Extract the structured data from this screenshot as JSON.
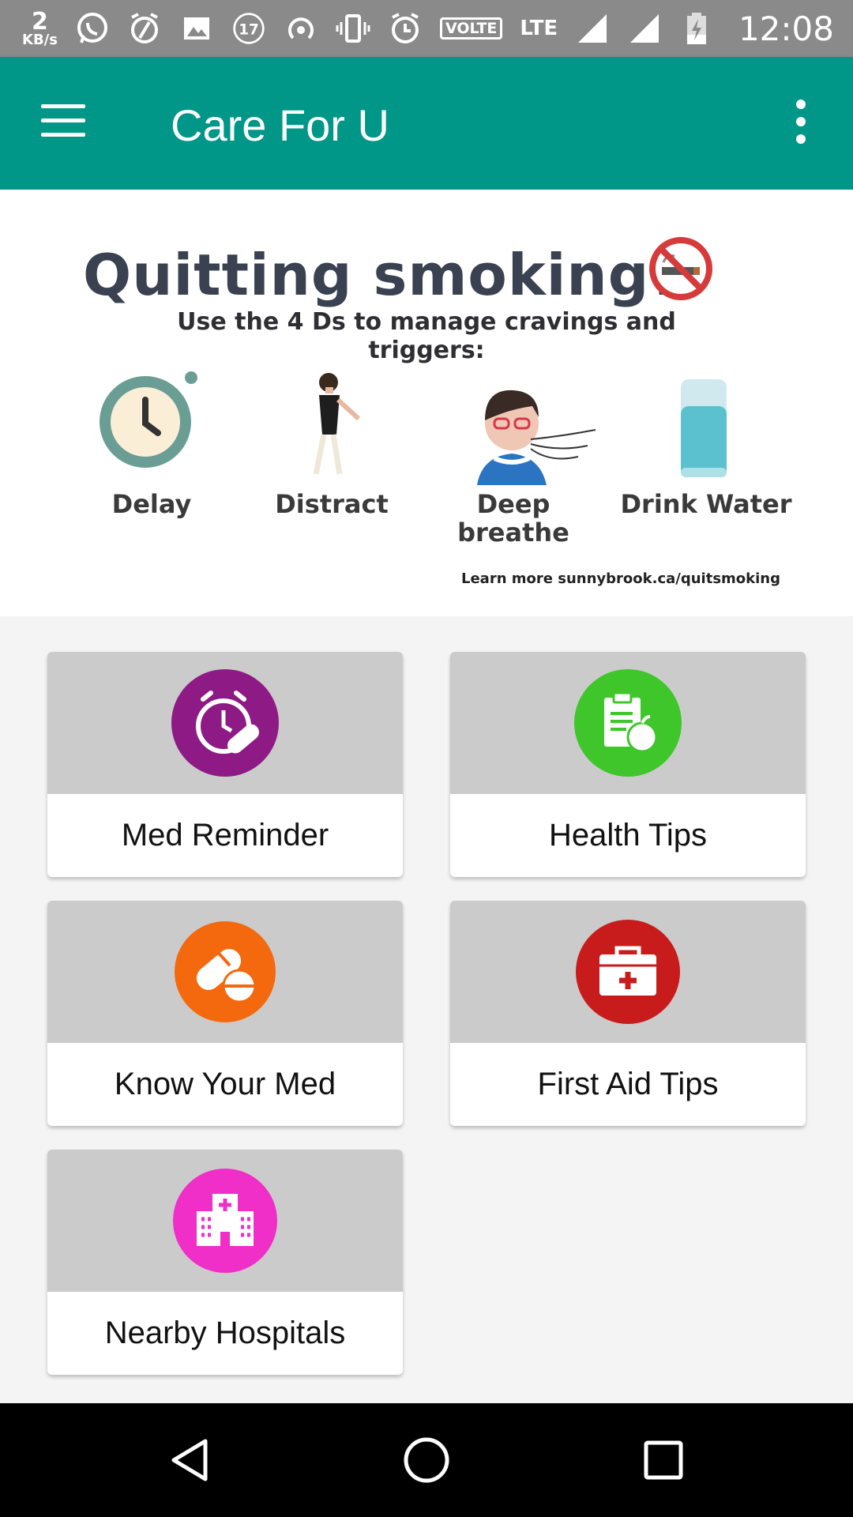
{
  "status_bar": {
    "network_speed_value": "2",
    "network_speed_unit": "KB/s",
    "notification_count": "17",
    "volte": "VOLTE",
    "lte": "LTE",
    "time": "12:08"
  },
  "app_bar": {
    "title": "Care For U"
  },
  "banner": {
    "title": "Quitting smoking?",
    "subtitle": "Use the 4 Ds to manage cravings and triggers:",
    "items": [
      {
        "label": "Delay"
      },
      {
        "label": "Distract"
      },
      {
        "label": "Deep breathe"
      },
      {
        "label": "Drink Water"
      }
    ],
    "link": "Learn more sunnybrook.ca/quitsmoking"
  },
  "cards": [
    {
      "label": "Med Reminder",
      "icon": "alarm-pill-icon",
      "color": "#8e1a85"
    },
    {
      "label": "Health Tips",
      "icon": "clipboard-apple-icon",
      "color": "#3ec62a"
    },
    {
      "label": "Know Your Med",
      "icon": "pill-capsule-icon",
      "color": "#f4680e"
    },
    {
      "label": "First Aid Tips",
      "icon": "first-aid-kit-icon",
      "color": "#c81c1c"
    },
    {
      "label": "Nearby Hospitals",
      "icon": "hospital-icon",
      "color": "#f02ec8"
    }
  ],
  "colors": {
    "app_bar": "#009688",
    "status_bar": "#8a8a8a"
  }
}
